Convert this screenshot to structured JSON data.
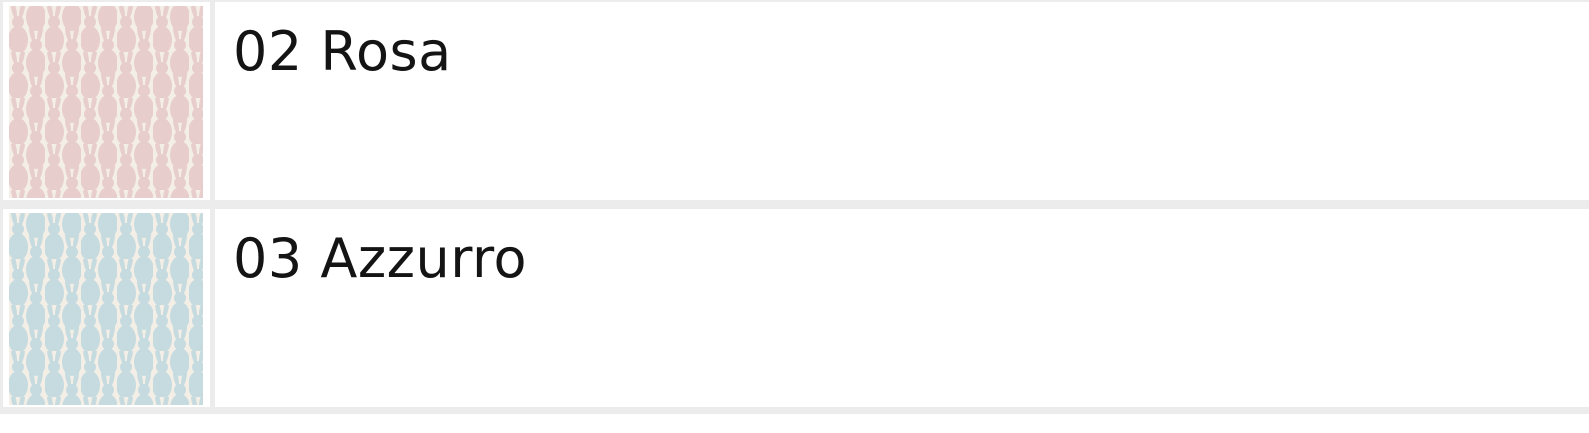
{
  "variants": [
    {
      "name": "02 Rosa",
      "swatch": {
        "pattern": "rabbit-silhouette-pattern",
        "ground_color": "#f4efe6",
        "motif_color": "#e8cdcd"
      }
    },
    {
      "name": "03 Azzurro",
      "swatch": {
        "pattern": "rabbit-silhouette-pattern",
        "ground_color": "#f4efe6",
        "motif_color": "#c6dbe0"
      }
    }
  ]
}
